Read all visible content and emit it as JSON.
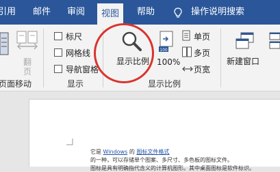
{
  "tabs": [
    {
      "label": "引用"
    },
    {
      "label": "邮件"
    },
    {
      "label": "审阅"
    },
    {
      "label": "视图",
      "active": true
    },
    {
      "label": "帮助"
    },
    {
      "label": "操作说明搜索"
    }
  ],
  "ribbon": {
    "page_move": {
      "flip_label": "翻\n页",
      "group_label": "页面移动"
    },
    "show": {
      "ruler": "标尺",
      "gridlines": "网格线",
      "nav_pane": "导航窗格",
      "group_label": "显示"
    },
    "zoom": {
      "zoom_label": "显示比例",
      "percent_label": "100%",
      "single_page": "单页",
      "multi_page": "多页",
      "page_width": "页宽",
      "group_label": "显示比例"
    },
    "window": {
      "new_window": "新建窗口"
    }
  },
  "document": {
    "line1_prefix": "它是",
    "line1_link1": "Windows",
    "line1_mid": "的",
    "line1_link2": "图标文件格式",
    "line2": "的一种，可以存储单个图案、多尺寸、多色板的图标文件。",
    "line3": "图标是具有明确指代含义的计算机图形。其中桌面图标是软件标识。"
  },
  "colors": {
    "accent": "#2b579a",
    "highlight_circle": "#d9332e"
  }
}
